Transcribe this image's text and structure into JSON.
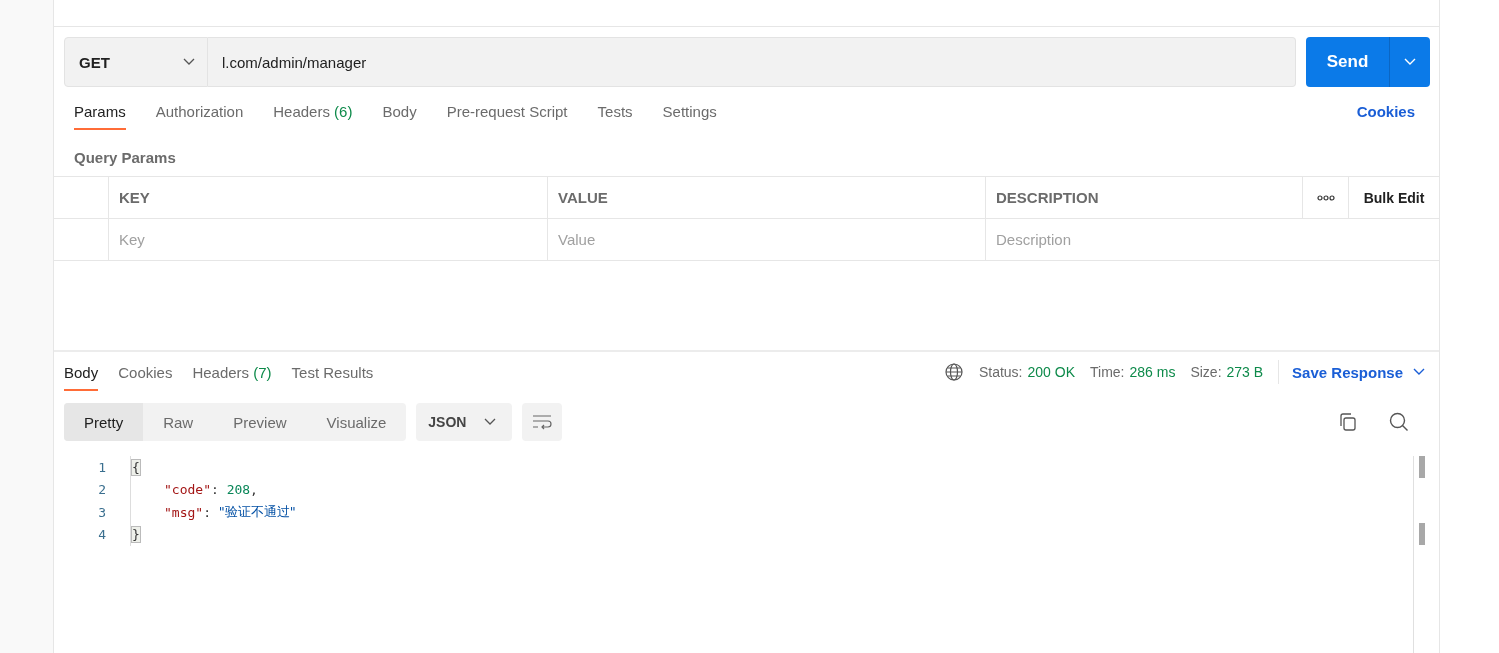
{
  "request": {
    "method": "GET",
    "url": "l.com/admin/manager",
    "send": "Send"
  },
  "request_tabs": [
    {
      "label": "Params",
      "selected": true
    },
    {
      "label": "Authorization",
      "selected": false
    },
    {
      "label": "Headers",
      "count": "(6)",
      "selected": false
    },
    {
      "label": "Body",
      "selected": false
    },
    {
      "label": "Pre-request Script",
      "selected": false
    },
    {
      "label": "Tests",
      "selected": false
    },
    {
      "label": "Settings",
      "selected": false
    }
  ],
  "cookies_link": "Cookies",
  "query_params": {
    "title": "Query Params",
    "columns": [
      "KEY",
      "VALUE",
      "DESCRIPTION"
    ],
    "bulk_edit": "Bulk Edit",
    "placeholders": [
      "Key",
      "Value",
      "Description"
    ]
  },
  "response_tabs": [
    {
      "label": "Body",
      "selected": true
    },
    {
      "label": "Cookies",
      "selected": false
    },
    {
      "label": "Headers",
      "count": "(7)",
      "selected": false
    },
    {
      "label": "Test Results",
      "selected": false
    }
  ],
  "status": [
    {
      "label": "Status:",
      "value": "200 OK"
    },
    {
      "label": "Time:",
      "value": "286 ms"
    },
    {
      "label": "Size:",
      "value": "273 B"
    }
  ],
  "save_response": "Save Response",
  "view_modes": [
    {
      "label": "Pretty",
      "selected": true
    },
    {
      "label": "Raw",
      "selected": false
    },
    {
      "label": "Preview",
      "selected": false
    },
    {
      "label": "Visualize",
      "selected": false
    }
  ],
  "format": "JSON",
  "code": [
    {
      "number": "1",
      "tokens": [
        {
          "kind": "brace",
          "text": "{"
        }
      ]
    },
    {
      "number": "2",
      "tokens": [
        {
          "kind": "key",
          "text": "\"code\""
        },
        {
          "kind": "punct",
          "text": ": "
        },
        {
          "kind": "number",
          "text": "208"
        },
        {
          "kind": "punct",
          "text": ","
        }
      ]
    },
    {
      "number": "3",
      "tokens": [
        {
          "kind": "key",
          "text": "\"msg\""
        },
        {
          "kind": "punct",
          "text": ": "
        },
        {
          "kind": "string",
          "text": "\"验证不通过\""
        }
      ]
    },
    {
      "number": "4",
      "tokens": [
        {
          "kind": "brace",
          "text": "}"
        }
      ]
    }
  ]
}
